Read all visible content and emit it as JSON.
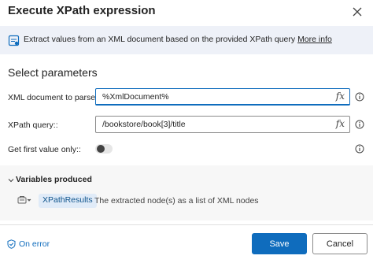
{
  "dialog": {
    "title": "Execute XPath expression"
  },
  "info": {
    "text": "Extract values from an XML document based on the provided XPath query",
    "link": "More info"
  },
  "params": {
    "section_title": "Select parameters",
    "xml_document": {
      "label": "XML document to parse::",
      "value": "%XmlDocument%",
      "fx": "fx"
    },
    "xpath_query": {
      "label": "XPath query::",
      "value": "/bookstore/book[3]/title",
      "fx": "fx"
    },
    "first_value_only": {
      "label": "Get first value only::",
      "checked": false
    }
  },
  "variables": {
    "title": "Variables produced",
    "items": [
      {
        "name": "XPathResults",
        "description": "The extracted node(s) as a list of XML nodes"
      }
    ]
  },
  "footer": {
    "on_error": "On error",
    "save": "Save",
    "cancel": "Cancel"
  },
  "colors": {
    "accent": "#0f6cbd",
    "banner_bg": "#eef1f8",
    "chip_bg": "#e0ebf8"
  }
}
